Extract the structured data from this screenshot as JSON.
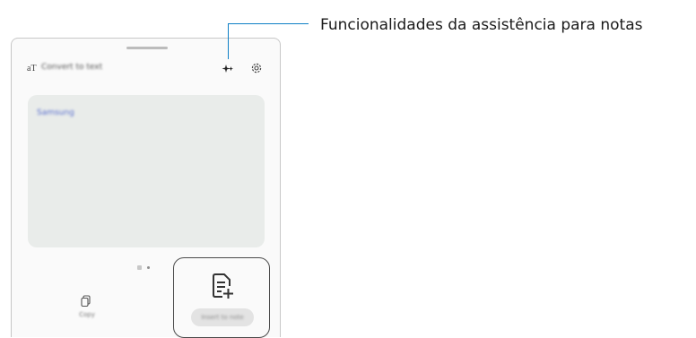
{
  "panel": {
    "title": "Convert to text",
    "content_text": "Samsung",
    "left_button_label": "Copy",
    "card_button_label": "Insert to note"
  },
  "callout": {
    "text": "Funcionalidades da assistência para notas",
    "color": "#0f7fc6"
  },
  "icons": {
    "convert": "text-size-icon",
    "assist": "sparkle-icon",
    "settings": "gear-icon",
    "copy": "copy-icon",
    "note_add": "note-add-icon"
  }
}
